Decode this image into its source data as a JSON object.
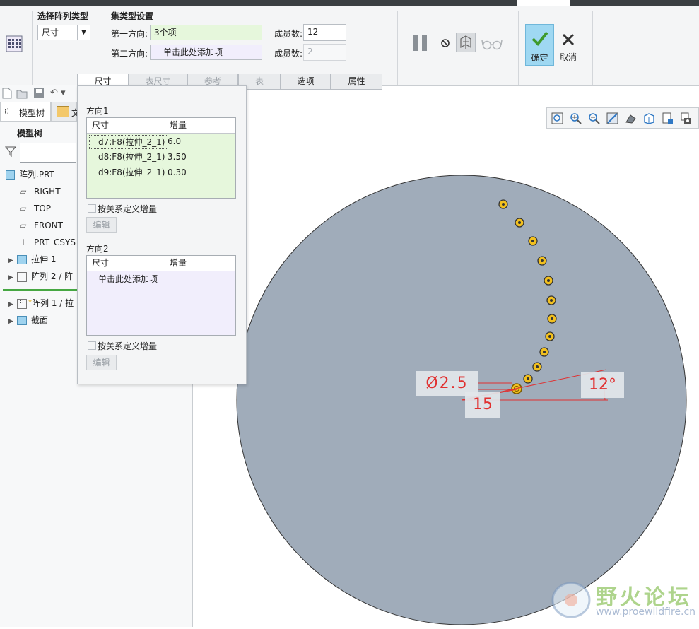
{
  "dashboard": {
    "pattern_type_label": "选择阵列类型",
    "pattern_type_value": "尺寸",
    "set_type_label": "集类型设置",
    "dir1_label": "第一方向:",
    "dir1_value": "3个项",
    "dir2_label": "第二方向:",
    "dir2_value": "单击此处添加项",
    "members1_label": "成员数:",
    "members1_value": "12",
    "members2_label": "成员数:",
    "members2_value": "2",
    "ok_label": "确定",
    "cancel_label": "取消"
  },
  "tabs": [
    "尺寸",
    "表尺寸",
    "参考",
    "表",
    "选项",
    "属性"
  ],
  "left_panel": {
    "tab_model_tree": "模型树",
    "tab_files": "文",
    "heading": "模型树",
    "tree": [
      {
        "label": "阵列.PRT",
        "icon": "part-icon"
      },
      {
        "label": "RIGHT",
        "icon": "datum-plane-icon"
      },
      {
        "label": "TOP",
        "icon": "datum-plane-icon"
      },
      {
        "label": "FRONT",
        "icon": "datum-plane-icon"
      },
      {
        "label": "PRT_CSYS_",
        "icon": "csys-icon"
      },
      {
        "label": "拉伸 1",
        "icon": "extrude-icon"
      },
      {
        "label": "阵列 2 / 阵",
        "icon": "pattern-icon"
      },
      {
        "label": "阵列 1 / 拉",
        "icon": "pattern-icon"
      },
      {
        "label": "截面",
        "icon": "section-icon"
      }
    ]
  },
  "popup": {
    "direction1_label": "方向1",
    "col_dimension": "尺寸",
    "col_increment": "增量",
    "dir1_rows": [
      {
        "dim": "d7:F8(拉伸_2_1)",
        "inc": "6.0"
      },
      {
        "dim": "d8:F8(拉伸_2_1)",
        "inc": "3.50"
      },
      {
        "dim": "d9:F8(拉伸_2_1)",
        "inc": "0.30"
      }
    ],
    "relation_increment_label": "按关系定义增量",
    "edit_label": "编辑",
    "direction2_label": "方向2",
    "dir2_placeholder": "单击此处添加项"
  },
  "viewport": {
    "dim_diameter": "Ø2.5",
    "dim_length": "15",
    "dim_angle": "12°"
  },
  "watermark": {
    "title": "野火论坛",
    "url": "www.proewildfire.cn"
  },
  "colors": {
    "accent_green": "#e6f7dc",
    "accent_lavender": "#f1eefc",
    "model_fill": "#a0acba",
    "ok_button": "#9fd8f2",
    "dimension_red": "#e03030",
    "hole_yellow": "#f2c01e"
  }
}
